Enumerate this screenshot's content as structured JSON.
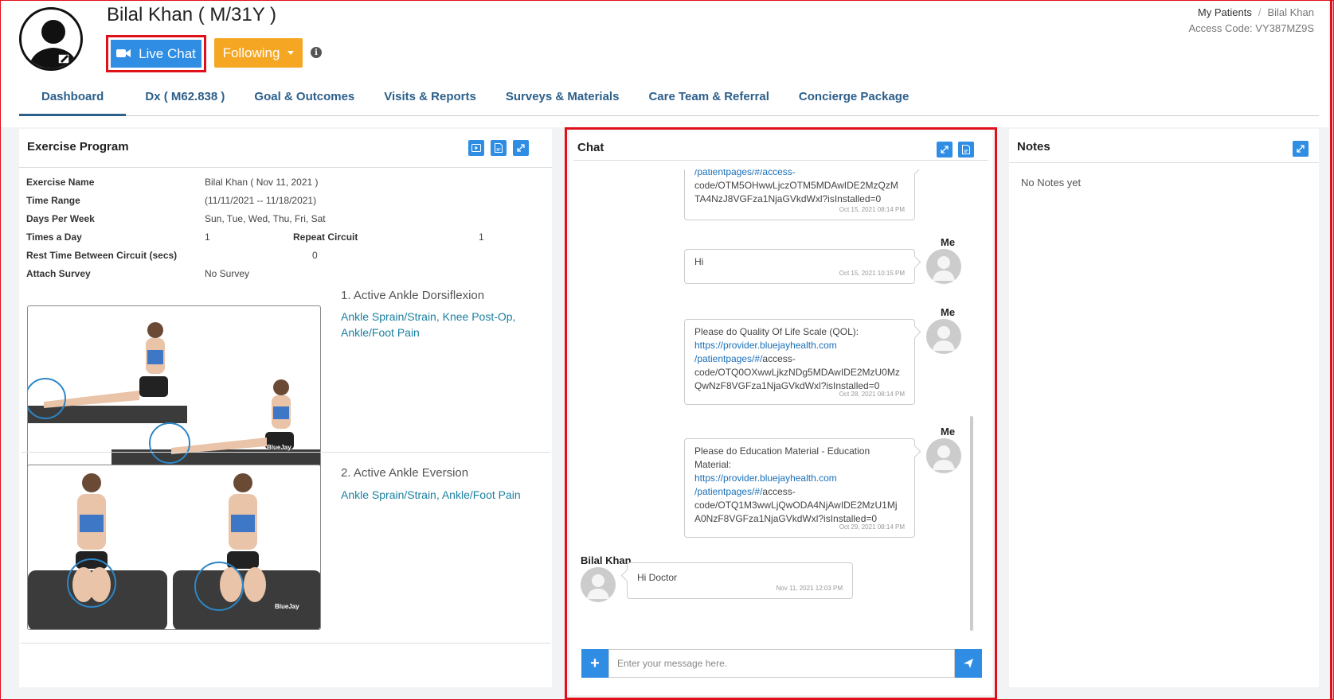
{
  "patient": {
    "name": "Bilal Khan ( M/31Y )"
  },
  "header": {
    "live_chat_label": "Live Chat",
    "following_label": "Following",
    "info_icon": "info-icon",
    "breadcrumb_root": "My Patients",
    "breadcrumb_current": "Bilal Khan",
    "access_code": "Access Code: VY387MZ9S"
  },
  "tabs": [
    {
      "label": "Dashboard",
      "active": true
    },
    {
      "label": "Dx ( M62.838 )"
    },
    {
      "label": "Goal & Outcomes"
    },
    {
      "label": "Visits & Reports"
    },
    {
      "label": "Surveys & Materials"
    },
    {
      "label": "Care Team & Referral"
    },
    {
      "label": "Concierge Package"
    }
  ],
  "exercise": {
    "title": "Exercise Program",
    "fields": {
      "name_label": "Exercise Name",
      "name_value": "Bilal Khan ( Nov 11, 2021 )",
      "range_label": "Time Range",
      "range_value": "(11/11/2021 -- 11/18/2021)",
      "days_label": "Days Per Week",
      "days_value": "Sun, Tue, Wed, Thu, Fri, Sat",
      "times_label": "Times a Day",
      "times_value": "1",
      "repeat_label": "Repeat Circuit",
      "repeat_value": "1",
      "rest_label": "Rest Time Between Circuit (secs)",
      "rest_value": "0",
      "survey_label": "Attach Survey",
      "survey_value": "No Survey"
    },
    "items": [
      {
        "name": "1. Active Ankle Dorsiflexion",
        "tags": "Ankle Sprain/Strain, Knee Post-Op, Ankle/Foot Pain",
        "watermark": "BlueJay"
      },
      {
        "name": "2. Active Ankle Eversion",
        "tags": "Ankle Sprain/Strain, Ankle/Foot Pain",
        "watermark": "BlueJay"
      }
    ]
  },
  "chat": {
    "title": "Chat",
    "messages": [
      {
        "lines": [
          "/patientpages/#/access-",
          "code/OTM5OHwwLjczOTM5MDAwIDE2MzQzM",
          "TA4NzJ8VGFza1NjaGVkdWxl?isInstalled=0"
        ],
        "time": "Oct 15, 2021 08:14 PM"
      },
      {
        "sender": "Me",
        "lines": [
          "Hi"
        ],
        "time": "Oct 15, 2021 10:15 PM"
      },
      {
        "sender": "Me",
        "line1": "Please do Quality Of Life Scale (QOL):",
        "link": "https://provider.bluejayhealth.com",
        "link2": "/patientpages/#/",
        "rest1": "access-",
        "line3": "code/OTQ0OXwwLjkzNDg5MDAwIDE2MzU0Mz",
        "line4": "QwNzF8VGFza1NjaGVkdWxl?isInstalled=0",
        "time": "Oct 28, 2021 08:14 PM"
      },
      {
        "sender": "Me",
        "line1": "Please do Education Material - Education",
        "line1b": "Material:",
        "link": "https://provider.bluejayhealth.com",
        "link2": "/patientpages/#/",
        "rest1": "access-",
        "line3": "code/OTQ1M3wwLjQwODA4NjAwIDE2MzU1Mj",
        "line4": "A0NzF8VGFza1NjaGVkdWxl?isInstalled=0",
        "time": "Oct 29, 2021 08:14 PM"
      },
      {
        "sender": "Bilal Khan",
        "lines": [
          "Hi Doctor"
        ],
        "time": "Nov 11, 2021 12:03 PM"
      }
    ],
    "input_placeholder": "Enter your message here."
  },
  "notes": {
    "title": "Notes",
    "empty_text": "No Notes yet"
  },
  "colors": {
    "accent": "#2f8de4",
    "following": "#f5a623",
    "highlight": "#e0101a",
    "tab": "#2c5f8a",
    "tag": "#1a7f9f"
  }
}
